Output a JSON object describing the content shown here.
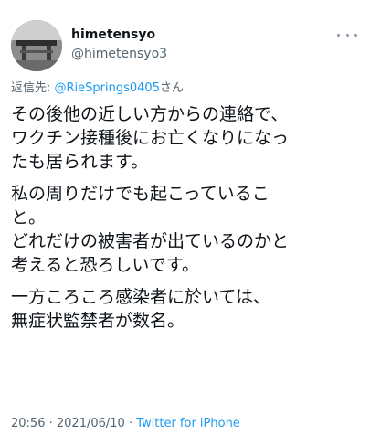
{
  "tweet": {
    "author": {
      "display_name": "himetensyo",
      "handle": "@himetensyo3",
      "avatar_icon": "avatar-photo"
    },
    "more_icon": "more-dots-icon",
    "reply": {
      "prefix": "返信先: ",
      "mention": "@RieSprings0405",
      "suffix": "さん"
    },
    "paragraphs": [
      [
        "その後他の近しい方からの連絡で、",
        "ワクチン接種後にお亡くなりになっ",
        "たも居られます。"
      ],
      [
        "私の周りだけでも起こっているこ",
        "と。",
        "どれだけの被害者が出ているのかと",
        "考えると恐ろしいです。"
      ],
      [
        "一方ころころ感染者に於いては、",
        "無症状監禁者が数名。"
      ]
    ],
    "meta": {
      "time": "20:56",
      "separator1": " · ",
      "date": "2021/06/10",
      "separator2": " · ",
      "source": "Twitter for iPhone"
    }
  },
  "colors": {
    "text": "#0f1419",
    "secondary": "#536471",
    "link": "#1d9bf0"
  }
}
